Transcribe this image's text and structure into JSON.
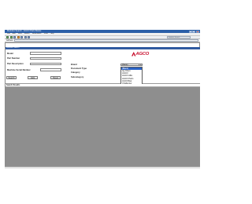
{
  "window": {
    "title": "Modules Search - AGCO Parts Books"
  },
  "menubar": {
    "items": [
      "File",
      "Edit",
      "View",
      "Search",
      "Bookmarks",
      "Tools",
      "Help"
    ]
  },
  "toolbar": {
    "search_placeholder": "Modules Search"
  },
  "address": {
    "label": "Address"
  },
  "panel": {
    "header": "Modules Search"
  },
  "form": {
    "model_label": "Model",
    "part_number_label": "Part Number",
    "part_description_label": "Part Description",
    "machine_serial_label": "Machine Serial Number",
    "brand_label": "Brand",
    "document_type_label": "Document Type",
    "category_label": "Category",
    "subcategory_label": "Subcategory",
    "brand_selected": "(Blank)",
    "search_button": "Search",
    "help_button": "Help",
    "reset_button": "Reset"
  },
  "logo": {
    "text": "AGCO"
  },
  "brand_options": [
    "(Blank)",
    "Ag Chem",
    "AGCO",
    "AGCO Allis",
    "AGCO Parts",
    "AGCOStar",
    "Challenger",
    "Farmhand",
    "Fella",
    "Fendt",
    "General Publications",
    "Gleaner",
    "Glencoe",
    "GSI",
    "Hesston",
    "Laverda",
    "Massey Ferguson",
    "New Idea",
    "Spra-Coupe",
    "SunFlower",
    "Tye",
    "Valtra",
    "White",
    "White Planters",
    "Willmar"
  ],
  "results": {
    "header": "Search Results"
  },
  "colors": {
    "title_bar": "#2b5fa8",
    "panel_header": "#2f5aa0",
    "results_background": "#8e8e8e",
    "dropdown_selection": "#2b62c4",
    "logo_red": "#c8102e"
  }
}
